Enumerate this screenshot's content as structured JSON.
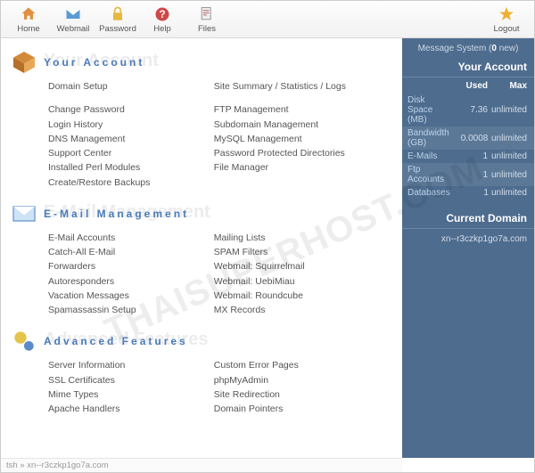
{
  "toolbar": {
    "items": [
      {
        "label": "Home",
        "icon": "home"
      },
      {
        "label": "Webmail",
        "icon": "mail"
      },
      {
        "label": "Password",
        "icon": "lock"
      },
      {
        "label": "Help",
        "icon": "help"
      },
      {
        "label": "Files",
        "icon": "files"
      }
    ],
    "logout": {
      "label": "Logout",
      "icon": "star"
    }
  },
  "message_system": {
    "prefix": "Message System (",
    "count": "0",
    "suffix": " new)"
  },
  "side": {
    "account_title": "Your Account",
    "used_label": "Used",
    "max_label": "Max",
    "rows": [
      {
        "label": "Disk Space (MB)",
        "used": "7.36",
        "max": "unlimited"
      },
      {
        "label": "Bandwidth (GB)",
        "used": "0.0008",
        "max": "unlimited"
      },
      {
        "label": "E-Mails",
        "used": "1",
        "max": "unlimited"
      },
      {
        "label": "Ftp Accounts",
        "used": "1",
        "max": "unlimited"
      },
      {
        "label": "Databases",
        "used": "1",
        "max": "unlimited"
      }
    ],
    "domain_title": "Current Domain",
    "domain_value": "xn--r3czkp1go7a.com"
  },
  "sections": [
    {
      "title": "Your Account",
      "shadow": "Your Account",
      "icon": "account",
      "left": [
        "Domain Setup",
        "",
        "Change Password",
        "Login History",
        "DNS Management",
        "Support Center",
        "Installed Perl Modules",
        "Create/Restore Backups"
      ],
      "right": [
        "Site Summary / Statistics / Logs",
        "",
        "FTP Management",
        "Subdomain Management",
        "MySQL Management",
        "Password Protected Directories",
        "File Manager"
      ]
    },
    {
      "title": "E-Mail Management",
      "shadow": "E-Mail Management",
      "icon": "email",
      "left": [
        "E-Mail Accounts",
        "Catch-All E-Mail",
        "Forwarders",
        "Autoresponders",
        "Vacation Messages",
        "Spamassassin Setup"
      ],
      "right": [
        "Mailing Lists",
        "SPAM Filters",
        "Webmail: Squirrelmail",
        "Webmail: UebiMiau",
        "Webmail: Roundcube",
        "MX Records"
      ]
    },
    {
      "title": "Advanced Features",
      "shadow": "Advanced Features",
      "icon": "advanced",
      "left": [
        "Server Information",
        "SSL Certificates",
        "Mime Types",
        "Apache Handlers"
      ],
      "right": [
        "Custom Error Pages",
        "phpMyAdmin",
        "Site Redirection",
        "Domain Pointers"
      ]
    }
  ],
  "breadcrumb": {
    "root": "tsh",
    "sep": "»",
    "domain": "xn--r3czkp1go7a.com"
  },
  "watermark": "THAISUPERHOST.COM"
}
